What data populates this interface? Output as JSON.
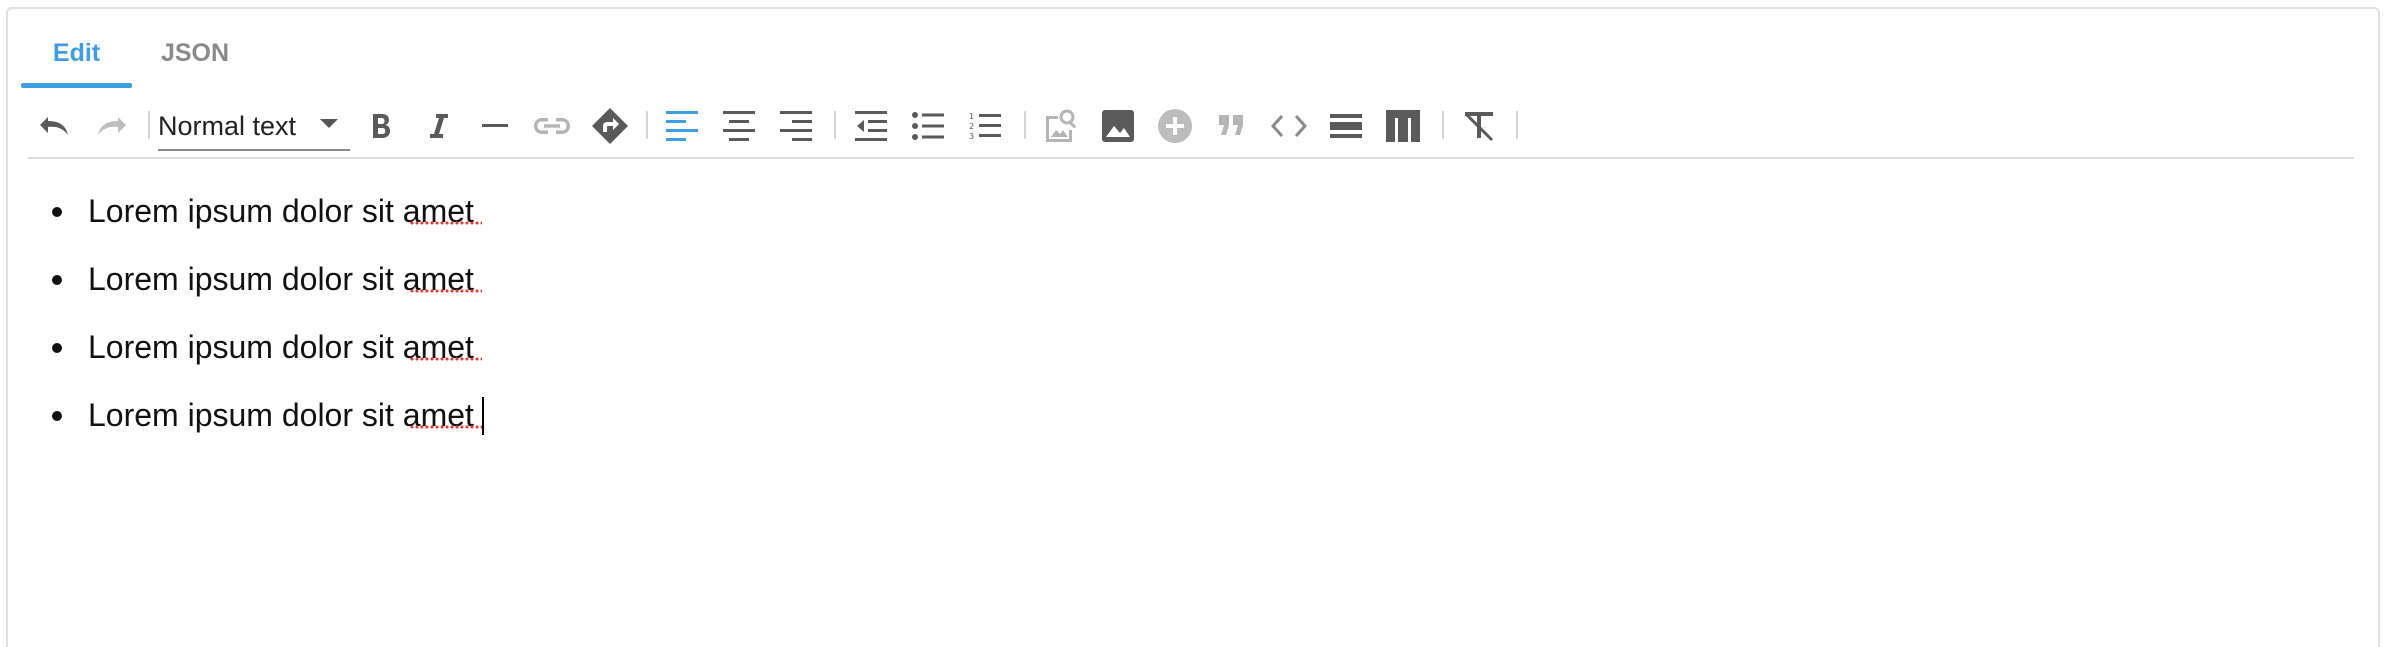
{
  "tabs": [
    {
      "label": "Edit",
      "active": true
    },
    {
      "label": "JSON",
      "active": false
    }
  ],
  "toolbar": {
    "block_format": "Normal text",
    "buttons": [
      {
        "name": "undo-icon"
      },
      {
        "name": "redo-icon"
      },
      {
        "name": "bold-icon"
      },
      {
        "name": "italic-icon"
      },
      {
        "name": "horizontal-rule-icon"
      },
      {
        "name": "link-icon"
      },
      {
        "name": "smart-link-icon"
      },
      {
        "name": "align-left-icon"
      },
      {
        "name": "align-center-icon"
      },
      {
        "name": "align-right-icon"
      },
      {
        "name": "outdent-icon"
      },
      {
        "name": "bullet-list-icon"
      },
      {
        "name": "numbered-list-icon"
      },
      {
        "name": "image-search-icon"
      },
      {
        "name": "image-icon"
      },
      {
        "name": "add-circle-icon"
      },
      {
        "name": "quote-icon"
      },
      {
        "name": "code-icon"
      },
      {
        "name": "divider-block-icon"
      },
      {
        "name": "table-icon"
      },
      {
        "name": "clear-formatting-icon"
      }
    ],
    "accent_color": "#3e9ee4"
  },
  "content": {
    "list_items": [
      "Lorem ipsum dolor sit amet",
      "Lorem ipsum dolor sit amet",
      "Lorem ipsum dolor sit amet",
      "Lorem ipsum dolor sit amet"
    ]
  }
}
